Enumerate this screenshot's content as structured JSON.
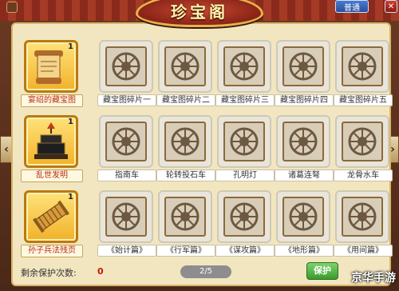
{
  "window": {
    "title": "珍宝阁",
    "top_left_button": "",
    "top_right_button": "普通"
  },
  "rows": [
    {
      "main": {
        "label": "宴绍的藏宝图",
        "count": "1",
        "icon": "treasure-map-scroll-icon"
      },
      "fragments": [
        "藏宝图碎片一",
        "藏宝图碎片二",
        "藏宝图碎片三",
        "藏宝图碎片四",
        "藏宝图碎片五"
      ]
    },
    {
      "main": {
        "label": "乱世发明",
        "count": "1",
        "icon": "invention-device-icon"
      },
      "fragments": [
        "指南车",
        "轮转投石车",
        "孔明灯",
        "诸葛连弩",
        "龙骨水车"
      ]
    },
    {
      "main": {
        "label": "孙子兵法残页",
        "count": "1",
        "icon": "bamboo-scroll-icon"
      },
      "fragments": [
        "《始计篇》",
        "《行军篇》",
        "《谋攻篇》",
        "《地形篇》",
        "《用间篇》"
      ]
    }
  ],
  "footer": {
    "remaining_label": "剩余保护次数:",
    "remaining_value": "0",
    "page": "2/5",
    "protect_button": "保护"
  },
  "watermark": "京华手游",
  "colors": {
    "panel_bg": "#f2e6c0",
    "highlight": "#f1b22a",
    "red_text": "#b82f14"
  }
}
